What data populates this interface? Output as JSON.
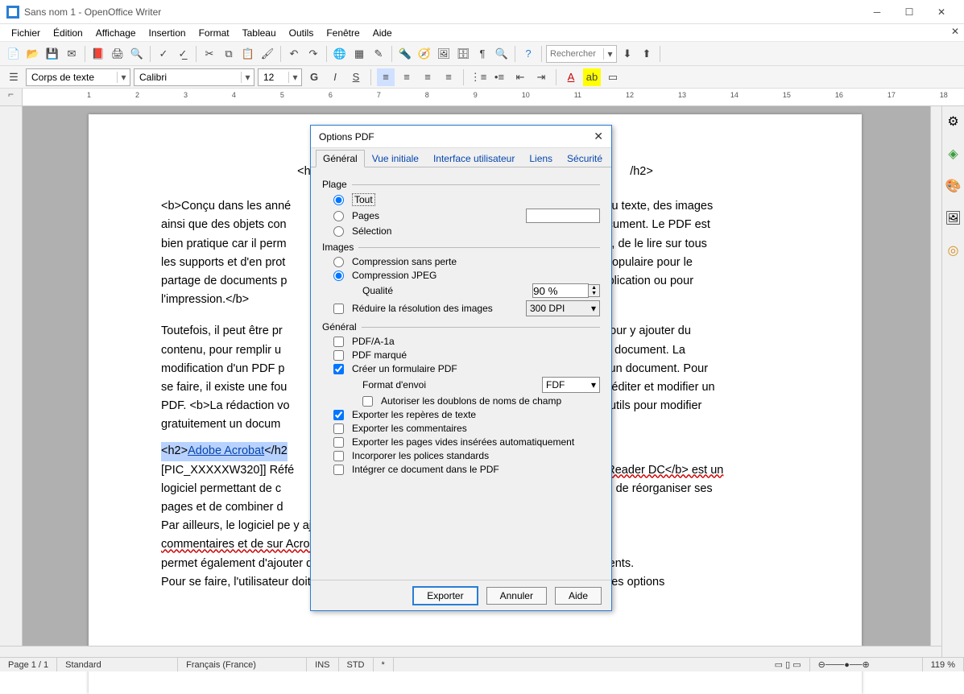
{
  "window": {
    "title": "Sans nom 1 - OpenOffice Writer"
  },
  "menu": [
    "Fichier",
    "Édition",
    "Affichage",
    "Insertion",
    "Format",
    "Tableau",
    "Outils",
    "Fenêtre",
    "Aide"
  ],
  "search_placeholder": "Rechercher",
  "format": {
    "style": "Corps de texte",
    "font": "Calibri",
    "size": "12"
  },
  "ruler": [
    "1",
    "2",
    "3",
    "4",
    "5",
    "6",
    "7",
    "8",
    "9",
    "10",
    "11",
    "12",
    "13",
    "14",
    "15",
    "16",
    "17",
    "18"
  ],
  "document": {
    "h2_open": "<h2>",
    "h2_close": "/h2>",
    "para1_prefix": "<b>Conçu dans les anné",
    "para1_suffix_lines": [
      "nir du texte, des images",
      "ainsi que des objets con",
      "n document. Le PDF est",
      "bien pratique car il perm",
      "iginal, de le lire sur tous",
      "les supports et d'en prot",
      "lus populaire pour le",
      "partage de documents p",
      "a publication ou pour",
      "l'impression.</b>"
    ],
    "para2_lines_left": [
      "Toutefois, il peut être pr",
      "contenu, pour remplir u",
      "modification d'un PDF p",
      "se faire, il existe une fou",
      "PDF. <b>La rédaction vo",
      "gratuitement un docum"
    ],
    "para2_lines_right": [
      "DF pour y ajouter du",
      "r un document. La",
      "gner un document. Pour",
      "pour éditer et modifier un",
      "s outils pour modifier",
      ""
    ],
    "h2b_open": "<h2>",
    "h2b_text": "Adobe Acrobat",
    "h2b_close": "</h2",
    "para3_lines_left": [
      "[PIC_XXXXXW320]] Réfé",
      "logiciel permettant de c",
      "pages et de combiner d"
    ],
    "para3_lines_right": [
      "t Reader DC</b> est un",
      "ents, de réorganiser ses",
      ""
    ],
    "para4": "Par ailleurs, le logiciel pe                                                                          y ajouter des",
    "para5": "commentaires et de sur                                                                       Acrobat Reader DC</b>",
    "para6": "permet également d'ajouter du texte pour remplir un formulaire et de signer ses documents.",
    "para7": "Pour se faire, l'utilisateur doit sélectionner l'onglet <i>Remplir et signer</i> puis choisir les options"
  },
  "dialog": {
    "title": "Options PDF",
    "tabs": [
      "Général",
      "Vue initiale",
      "Interface utilisateur",
      "Liens",
      "Sécurité"
    ],
    "active_tab": 0,
    "grp_range": "Plage",
    "radio_all": "Tout",
    "radio_pages": "Pages",
    "radio_sel": "Sélection",
    "range_selected": "all",
    "pages_value": "",
    "grp_images": "Images",
    "radio_lossless": "Compression sans perte",
    "radio_jpeg": "Compression JPEG",
    "compression_selected": "jpeg",
    "quality_label": "Qualité",
    "quality": "90 %",
    "chk_reduce": "Réduire la résolution des images",
    "reduce_checked": false,
    "dpi": "300 DPI",
    "grp_general": "Général",
    "chk_pdfa": "PDF/A-1a",
    "pdfa": false,
    "chk_tagged": "PDF marqué",
    "tagged": false,
    "chk_form": "Créer un formulaire PDF",
    "form": true,
    "format_label": "Format d'envoi",
    "format_value": "FDF",
    "chk_dup": "Autoriser les doublons de noms de champ",
    "dup": false,
    "chk_bookmarks": "Exporter les repères de texte",
    "bookmarks": true,
    "chk_comments": "Exporter les commentaires",
    "comments": false,
    "chk_empty": "Exporter les pages vides insérées automatiquement",
    "empty": false,
    "chk_fonts": "Incorporer les polices standards",
    "fonts": false,
    "chk_embed": "Intégrer ce document dans le PDF",
    "embed": false,
    "btn_export": "Exporter",
    "btn_cancel": "Annuler",
    "btn_help": "Aide"
  },
  "status": {
    "page": "Page 1 / 1",
    "style": "Standard",
    "lang": "Français (France)",
    "ins": "INS",
    "std": "STD",
    "mod": "*",
    "zoom": "119 %"
  }
}
